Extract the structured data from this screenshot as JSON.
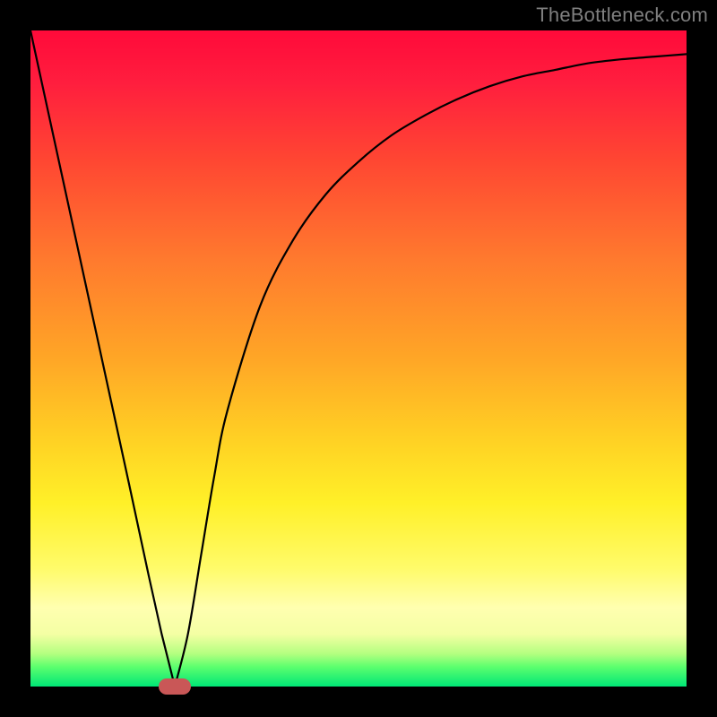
{
  "watermark": "TheBottleneck.com",
  "chart_data": {
    "type": "line",
    "title": "",
    "xlabel": "",
    "ylabel": "",
    "xlim": [
      0,
      100
    ],
    "ylim": [
      0,
      100
    ],
    "x": [
      0,
      5,
      10,
      15,
      18,
      20,
      22,
      24,
      26,
      28,
      30,
      35,
      40,
      45,
      50,
      55,
      60,
      65,
      70,
      75,
      80,
      85,
      90,
      95,
      100
    ],
    "y": [
      100,
      77,
      54,
      31,
      17,
      8,
      0,
      8,
      20,
      32,
      42,
      58,
      68,
      75,
      80,
      84,
      87,
      89.5,
      91.5,
      93,
      94,
      95,
      95.6,
      96,
      96.4
    ],
    "marker": {
      "x": 22,
      "y": 0
    },
    "background_gradient": {
      "top": "#ff0a3a",
      "mid_upper": "#ffa626",
      "mid": "#fff028",
      "mid_lower": "#ffffb0",
      "bottom": "#00e676"
    }
  }
}
